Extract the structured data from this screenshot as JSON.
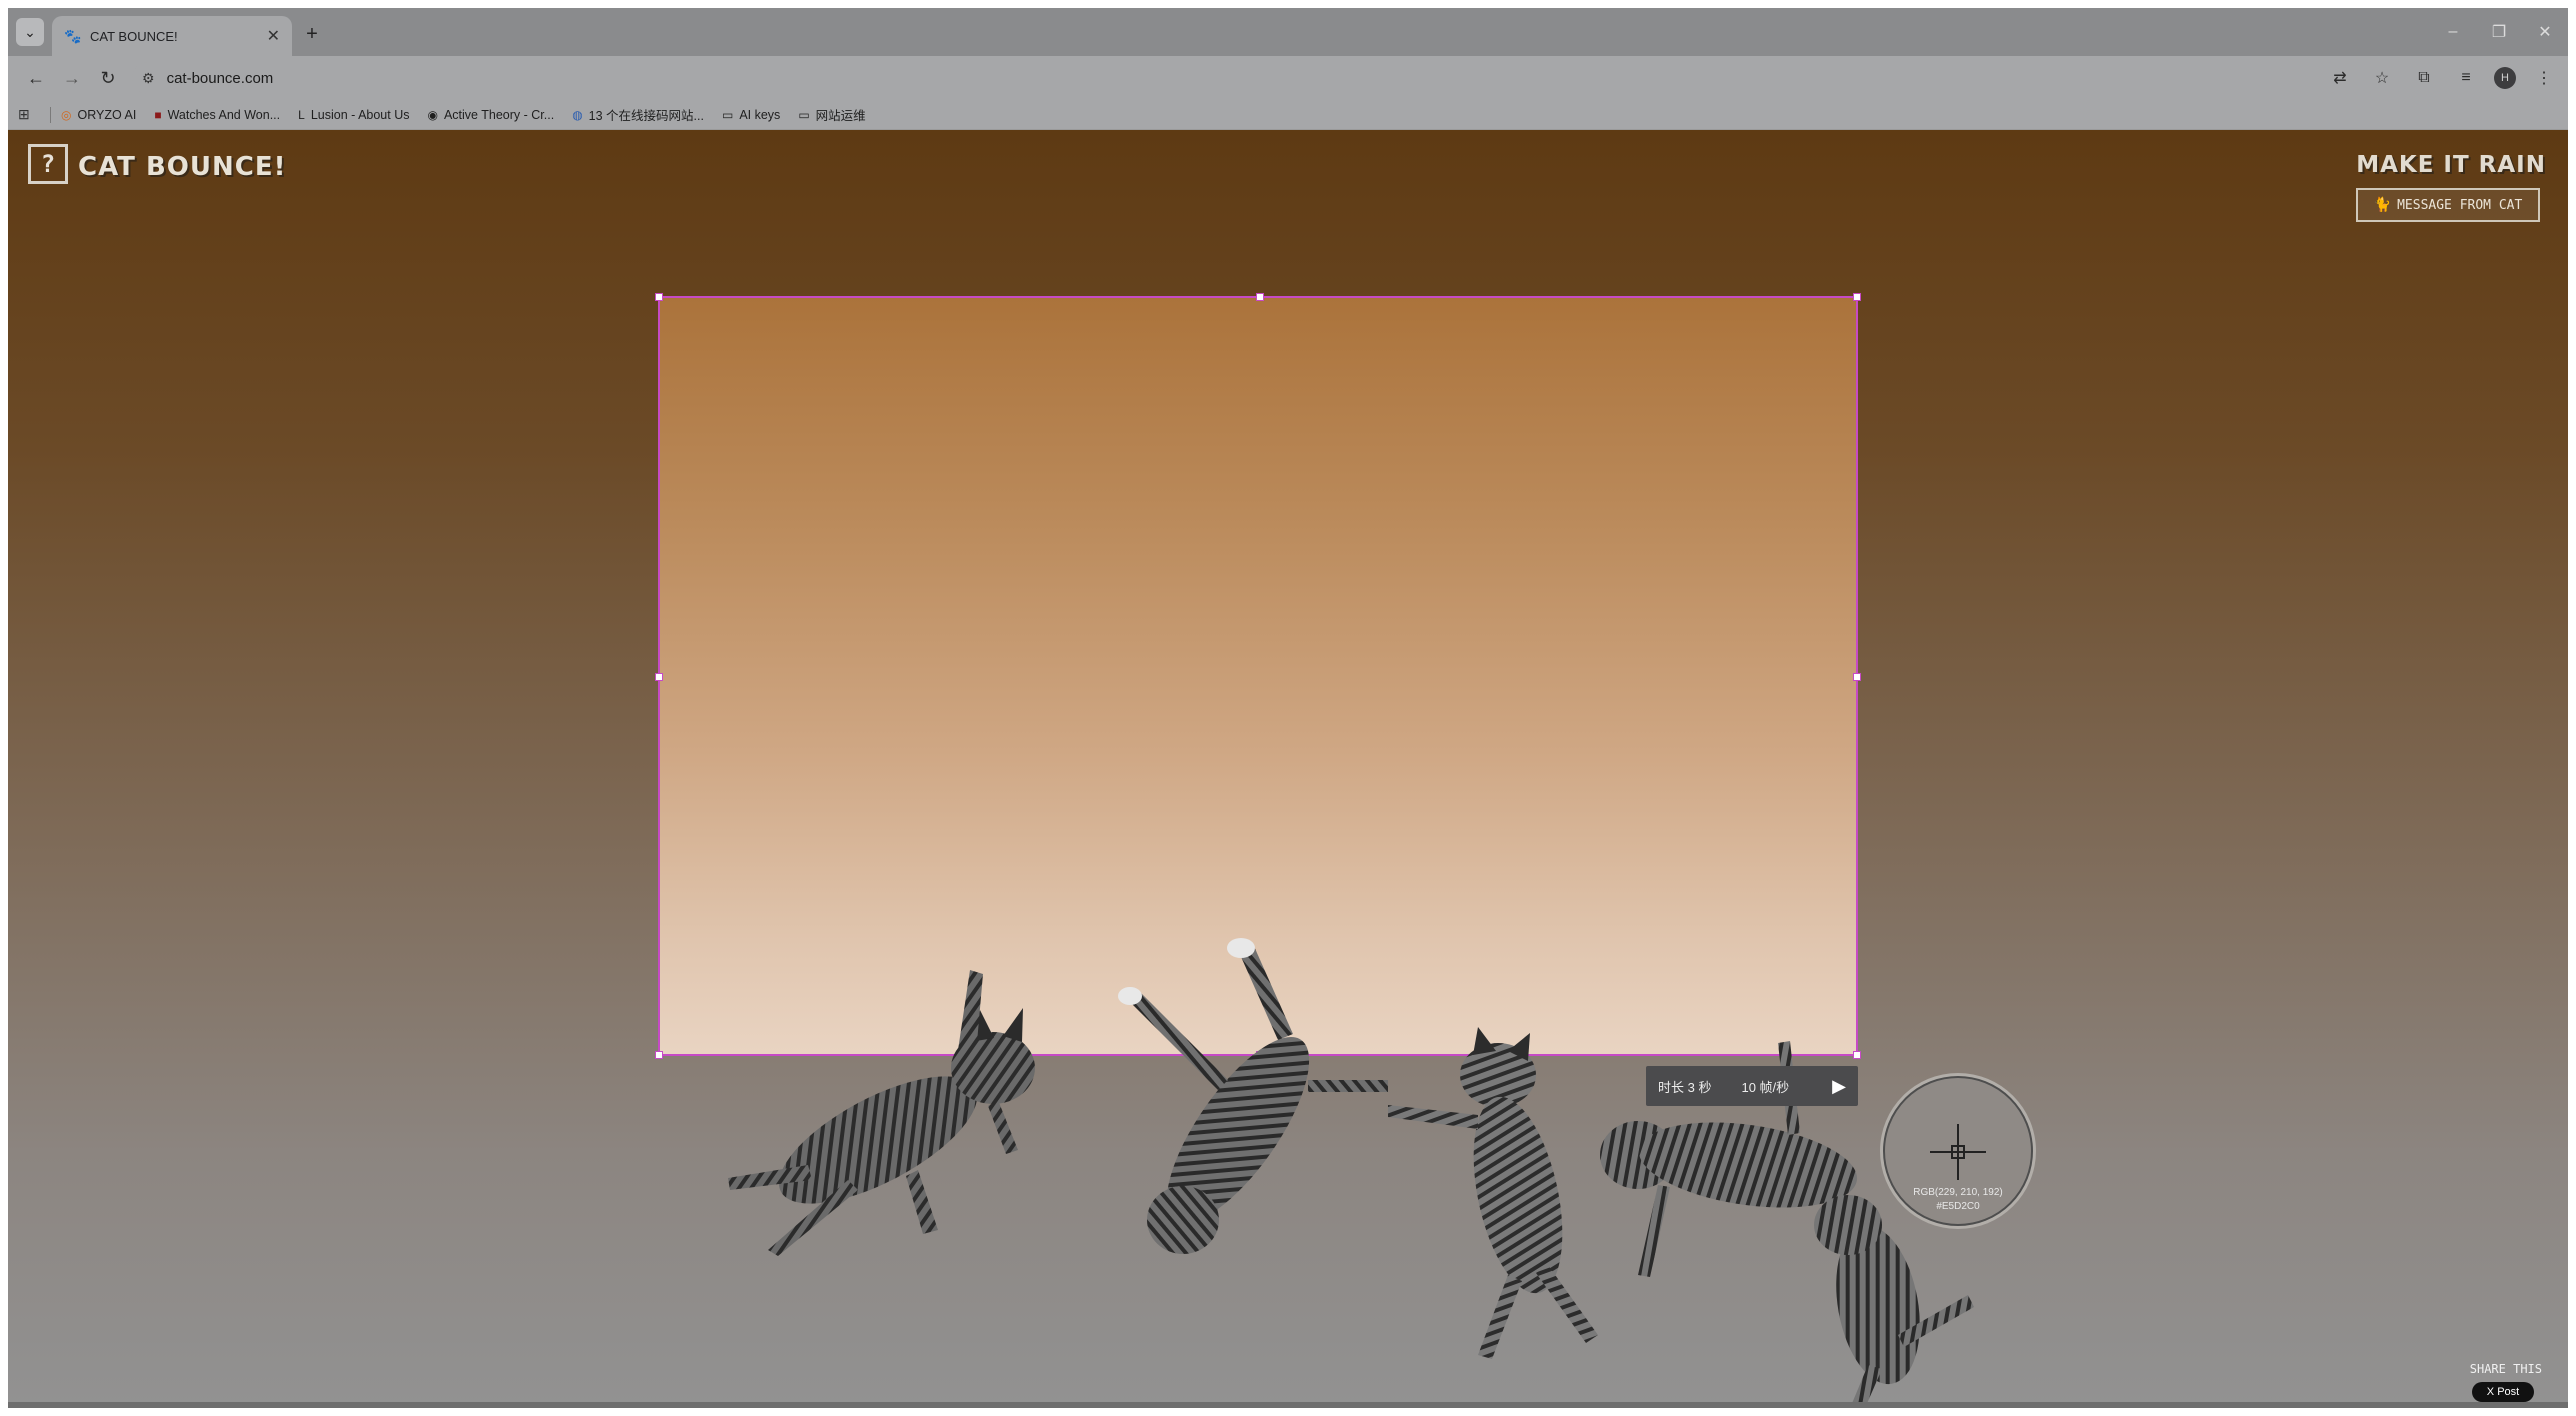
{
  "browser": {
    "tab_title": "CAT BOUNCE!",
    "url": "cat-bounce.com",
    "bookmarks": [
      "ORYZO AI",
      "Watches And Won...",
      "Lusion - About Us",
      "Active Theory - Cr...",
      "13 个在线接码网站...",
      "AI keys",
      "网站运维"
    ],
    "avatar_initial": "H"
  },
  "page": {
    "help_label": "?",
    "logo": "CAT BOUNCE!",
    "make_it_rain": "MAKE IT RAIN",
    "message_from_cat": "MESSAGE FROM CAT",
    "share_this": "SHARE THIS",
    "x_post": "X Post"
  },
  "capture": {
    "duration": "时长 3 秒",
    "fps": "10 帧/秒",
    "play_icon": "play-icon"
  },
  "color_picker": {
    "rgb": "RGB(229, 210, 192)",
    "hex": "#E5D2C0"
  },
  "colors": {
    "selection_border": "#c64ac6",
    "page_top": "#5e3a13",
    "page_bottom": "#929292"
  }
}
